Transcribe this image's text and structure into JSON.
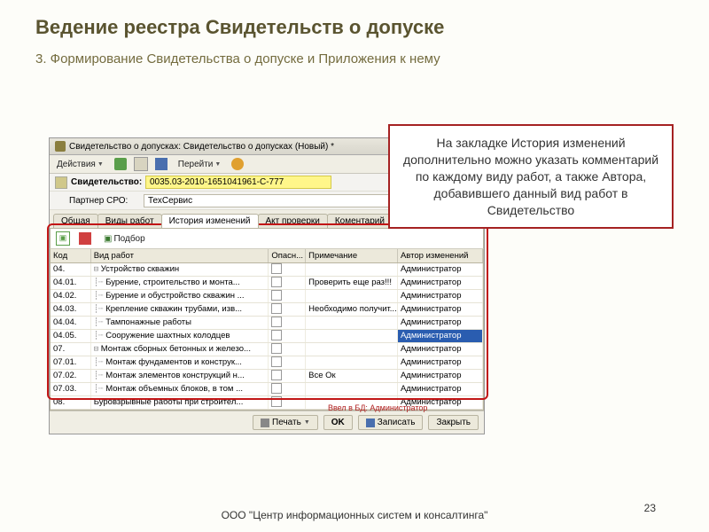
{
  "slide": {
    "title": "Ведение реестра Свидетельств о допуске",
    "subtitle": "3. Формирование Свидетельства о допуске и Приложения к нему",
    "footer": "ООО \"Центр информационных систем и консалтинга\"",
    "page": "23"
  },
  "callout": "На закладке История изменений дополнительно можно указать комментарий по каждому виду работ, а также Автора, добавившего данный вид работ в Свидетельство",
  "app": {
    "titlebar": "Свидетельство о допусках: Свидетельство о допусках (Новый) *",
    "toolbar": {
      "actions": "Действия",
      "goto": "Перейти"
    },
    "form": {
      "cert_label": "Свидетельство:",
      "cert_value": "0035.03-2010-1651041961-С-777",
      "partner_label": "Партнер СРО:",
      "partner_value": "ТехСервис"
    },
    "tabs": [
      "Общая",
      "Виды работ",
      "История изменений",
      "Акт проверки",
      "Коментарий"
    ],
    "grid_toolbar": {
      "select": "Подбор"
    },
    "columns": [
      "Код",
      "Вид работ",
      "Опасн...",
      "Примечание",
      "Автор изменений"
    ],
    "rows": [
      {
        "code": "04.",
        "work": "Устройство скважин",
        "tree": "⊟",
        "note": "",
        "author": "Администратор"
      },
      {
        "code": "04.01.",
        "work": "Бурение, строительство и монта...",
        "tree": "┊┈",
        "note": "Проверить еще раз!!!",
        "author": "Администратор"
      },
      {
        "code": "04.02.",
        "work": "Бурение и обустройство скважин ...",
        "tree": "┊┈",
        "note": "",
        "author": "Администратор"
      },
      {
        "code": "04.03.",
        "work": "Крепление скважин трубами, изв...",
        "tree": "┊┈",
        "note": "Необходимо получит...",
        "author": "Администратор"
      },
      {
        "code": "04.04.",
        "work": "Тампонажные работы",
        "tree": "┊┈",
        "note": "",
        "author": "Администратор"
      },
      {
        "code": "04.05.",
        "work": "Сооружение шахтных колодцев",
        "tree": "┊┈",
        "note": "",
        "author": "Администратор",
        "sel": true
      },
      {
        "code": "07.",
        "work": "Монтаж сборных бетонных и железо...",
        "tree": "⊟",
        "note": "",
        "author": "Администратор"
      },
      {
        "code": "07.01.",
        "work": "Монтаж фундаментов и конструк...",
        "tree": "┊┈",
        "note": "",
        "author": "Администратор"
      },
      {
        "code": "07.02.",
        "work": "Монтаж элементов конструкций н...",
        "tree": "┊┈",
        "note": "Все Ок",
        "author": "Администратор"
      },
      {
        "code": "07.03.",
        "work": "Монтаж объемных блоков, в том ...",
        "tree": "┊┈",
        "note": "",
        "author": "Администратор"
      },
      {
        "code": "08.",
        "work": "Буровзрывные работы при строител...",
        "tree": "",
        "note": "",
        "author": "Администратор"
      }
    ],
    "buttons": {
      "print": "Печать",
      "ok": "OK",
      "save": "Записать",
      "close": "Закрыть"
    },
    "db_note": "Ввел в БД:  Администратор"
  }
}
